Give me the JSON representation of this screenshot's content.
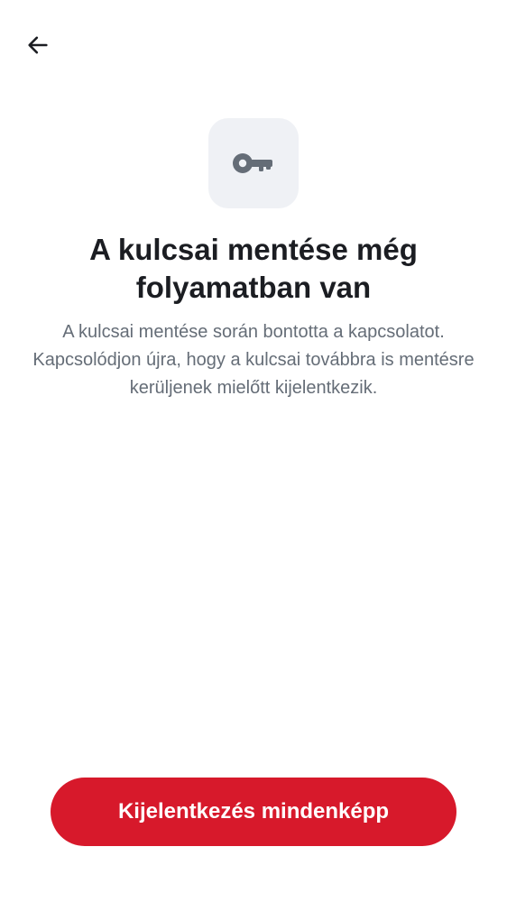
{
  "header": {
    "back_icon": "arrow-left-icon"
  },
  "hero": {
    "icon": "key-icon",
    "tile_color": "#eff1f5",
    "icon_color": "#656d77"
  },
  "content": {
    "title": "A kulcsai mentése még folyamatban van",
    "description": "A kulcsai mentése során bontotta a kapcsolatot. Kapcsolódjon újra, hogy a kulcsai továbbra is mentésre kerüljenek mielőtt kijelentkezik."
  },
  "actions": {
    "signout_anyway_label": "Kijelentkezés mindenképp",
    "button_color": "#d7192b"
  }
}
